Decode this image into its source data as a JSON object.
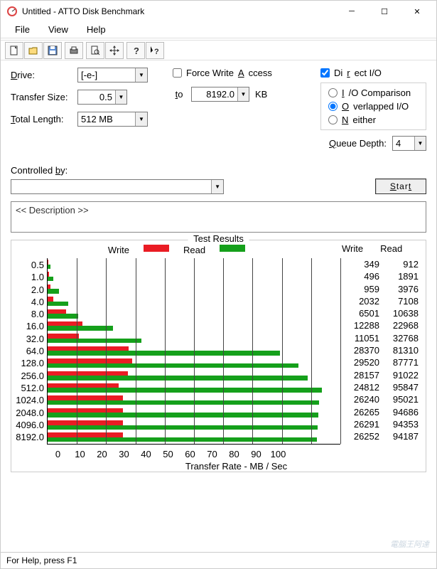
{
  "window": {
    "title": "Untitled - ATTO Disk Benchmark"
  },
  "menu": {
    "file": "File",
    "view": "View",
    "help": "Help"
  },
  "toolbar_icons": [
    "new",
    "open",
    "save",
    "print",
    "preview",
    "move",
    "help",
    "whatsthis"
  ],
  "labels": {
    "drive": "Drive:",
    "transfer": "Transfer Size:",
    "to": "to",
    "kb": "KB",
    "total_len": "Total Length:",
    "force": "Force Write Access",
    "directio": "Direct I/O",
    "iocomp": "I/O Comparison",
    "overlapped": "Overlapped I/O",
    "neither": "Neither",
    "qdepth": "Queue Depth:",
    "controlled": "Controlled by:",
    "start": "Start",
    "desc": "<< Description >>",
    "results": "Test Results",
    "write": "Write",
    "read": "Read",
    "xlabel": "Transfer Rate - MB / Sec"
  },
  "settings": {
    "drive": "[-e-]",
    "ts_from": "0.5",
    "ts_to": "8192.0",
    "total_length": "512 MB",
    "force_write": false,
    "direct_io": true,
    "io_mode": "overlapped",
    "queue_depth": "4",
    "controlled_by": ""
  },
  "status": "For Help, press F1",
  "watermark": "電腦王阿達",
  "chart_data": {
    "type": "bar",
    "orientation": "horizontal",
    "xlabel": "Transfer Rate - MB / Sec",
    "xlim": [
      0,
      100
    ],
    "xticks": [
      0,
      10,
      20,
      30,
      40,
      50,
      60,
      70,
      80,
      90,
      100
    ],
    "categories": [
      "0.5",
      "1.0",
      "2.0",
      "4.0",
      "8.0",
      "16.0",
      "32.0",
      "64.0",
      "128.0",
      "256.0",
      "512.0",
      "1024.0",
      "2048.0",
      "4096.0",
      "8192.0"
    ],
    "series": [
      {
        "name": "Write",
        "unit": "KB/s",
        "color": "#ea1c24",
        "values": [
          349,
          496,
          959,
          2032,
          6501,
          12288,
          11051,
          28370,
          29520,
          28157,
          24812,
          26240,
          26265,
          26291,
          26252
        ]
      },
      {
        "name": "Read",
        "unit": "KB/s",
        "color": "#15a01b",
        "values": [
          912,
          1891,
          3976,
          7108,
          10638,
          22968,
          32768,
          81310,
          87771,
          91022,
          95847,
          95021,
          94686,
          94353,
          94187
        ]
      }
    ]
  }
}
